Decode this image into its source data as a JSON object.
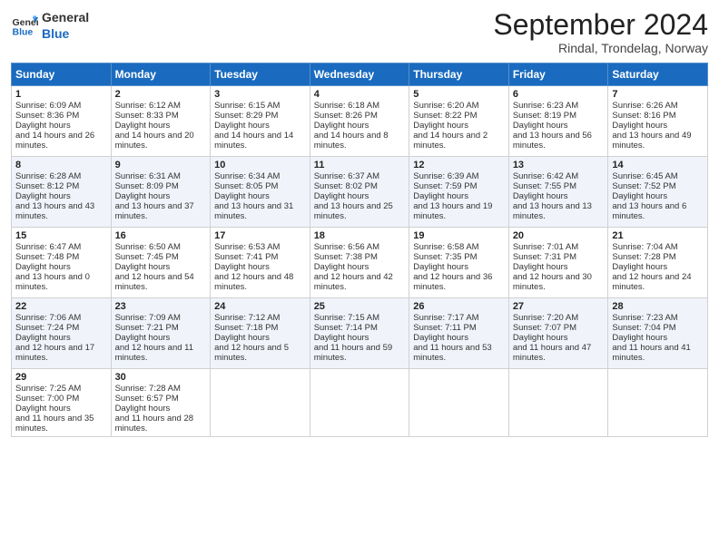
{
  "logo": {
    "general": "General",
    "blue": "Blue"
  },
  "header": {
    "month": "September 2024",
    "location": "Rindal, Trondelag, Norway"
  },
  "days": [
    "Sunday",
    "Monday",
    "Tuesday",
    "Wednesday",
    "Thursday",
    "Friday",
    "Saturday"
  ],
  "weeks": [
    [
      {
        "day": 1,
        "sunrise": "6:09 AM",
        "sunset": "8:36 PM",
        "daylight": "14 hours and 26 minutes."
      },
      {
        "day": 2,
        "sunrise": "6:12 AM",
        "sunset": "8:33 PM",
        "daylight": "14 hours and 20 minutes."
      },
      {
        "day": 3,
        "sunrise": "6:15 AM",
        "sunset": "8:29 PM",
        "daylight": "14 hours and 14 minutes."
      },
      {
        "day": 4,
        "sunrise": "6:18 AM",
        "sunset": "8:26 PM",
        "daylight": "14 hours and 8 minutes."
      },
      {
        "day": 5,
        "sunrise": "6:20 AM",
        "sunset": "8:22 PM",
        "daylight": "14 hours and 2 minutes."
      },
      {
        "day": 6,
        "sunrise": "6:23 AM",
        "sunset": "8:19 PM",
        "daylight": "13 hours and 56 minutes."
      },
      {
        "day": 7,
        "sunrise": "6:26 AM",
        "sunset": "8:16 PM",
        "daylight": "13 hours and 49 minutes."
      }
    ],
    [
      {
        "day": 8,
        "sunrise": "6:28 AM",
        "sunset": "8:12 PM",
        "daylight": "13 hours and 43 minutes."
      },
      {
        "day": 9,
        "sunrise": "6:31 AM",
        "sunset": "8:09 PM",
        "daylight": "13 hours and 37 minutes."
      },
      {
        "day": 10,
        "sunrise": "6:34 AM",
        "sunset": "8:05 PM",
        "daylight": "13 hours and 31 minutes."
      },
      {
        "day": 11,
        "sunrise": "6:37 AM",
        "sunset": "8:02 PM",
        "daylight": "13 hours and 25 minutes."
      },
      {
        "day": 12,
        "sunrise": "6:39 AM",
        "sunset": "7:59 PM",
        "daylight": "13 hours and 19 minutes."
      },
      {
        "day": 13,
        "sunrise": "6:42 AM",
        "sunset": "7:55 PM",
        "daylight": "13 hours and 13 minutes."
      },
      {
        "day": 14,
        "sunrise": "6:45 AM",
        "sunset": "7:52 PM",
        "daylight": "13 hours and 6 minutes."
      }
    ],
    [
      {
        "day": 15,
        "sunrise": "6:47 AM",
        "sunset": "7:48 PM",
        "daylight": "13 hours and 0 minutes."
      },
      {
        "day": 16,
        "sunrise": "6:50 AM",
        "sunset": "7:45 PM",
        "daylight": "12 hours and 54 minutes."
      },
      {
        "day": 17,
        "sunrise": "6:53 AM",
        "sunset": "7:41 PM",
        "daylight": "12 hours and 48 minutes."
      },
      {
        "day": 18,
        "sunrise": "6:56 AM",
        "sunset": "7:38 PM",
        "daylight": "12 hours and 42 minutes."
      },
      {
        "day": 19,
        "sunrise": "6:58 AM",
        "sunset": "7:35 PM",
        "daylight": "12 hours and 36 minutes."
      },
      {
        "day": 20,
        "sunrise": "7:01 AM",
        "sunset": "7:31 PM",
        "daylight": "12 hours and 30 minutes."
      },
      {
        "day": 21,
        "sunrise": "7:04 AM",
        "sunset": "7:28 PM",
        "daylight": "12 hours and 24 minutes."
      }
    ],
    [
      {
        "day": 22,
        "sunrise": "7:06 AM",
        "sunset": "7:24 PM",
        "daylight": "12 hours and 17 minutes."
      },
      {
        "day": 23,
        "sunrise": "7:09 AM",
        "sunset": "7:21 PM",
        "daylight": "12 hours and 11 minutes."
      },
      {
        "day": 24,
        "sunrise": "7:12 AM",
        "sunset": "7:18 PM",
        "daylight": "12 hours and 5 minutes."
      },
      {
        "day": 25,
        "sunrise": "7:15 AM",
        "sunset": "7:14 PM",
        "daylight": "11 hours and 59 minutes."
      },
      {
        "day": 26,
        "sunrise": "7:17 AM",
        "sunset": "7:11 PM",
        "daylight": "11 hours and 53 minutes."
      },
      {
        "day": 27,
        "sunrise": "7:20 AM",
        "sunset": "7:07 PM",
        "daylight": "11 hours and 47 minutes."
      },
      {
        "day": 28,
        "sunrise": "7:23 AM",
        "sunset": "7:04 PM",
        "daylight": "11 hours and 41 minutes."
      }
    ],
    [
      {
        "day": 29,
        "sunrise": "7:25 AM",
        "sunset": "7:00 PM",
        "daylight": "11 hours and 35 minutes."
      },
      {
        "day": 30,
        "sunrise": "7:28 AM",
        "sunset": "6:57 PM",
        "daylight": "11 hours and 28 minutes."
      },
      null,
      null,
      null,
      null,
      null
    ]
  ]
}
